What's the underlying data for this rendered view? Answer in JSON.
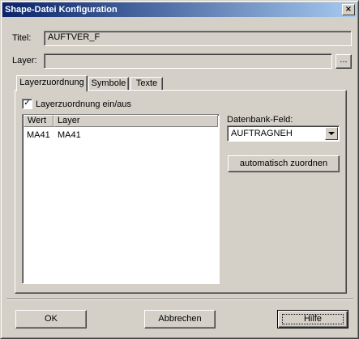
{
  "window": {
    "title": "Shape-Datei Konfiguration",
    "close_glyph": "×"
  },
  "fields": {
    "titel_label": "Titel:",
    "titel_value": "AUFTVER_F",
    "layer_label": "Layer:",
    "layer_value": "",
    "browse_label": "..."
  },
  "tabs": [
    "Layerzuordnung",
    "Symbole",
    "Texte"
  ],
  "layerzuordnung": {
    "checkbox_label": "Layerzuordnung ein/aus",
    "checkbox_checked": true,
    "checkbox_glyph": "✓",
    "columns": [
      "Wert",
      "Layer"
    ],
    "rows": [
      {
        "wert": "MA41",
        "layer": "MA41"
      }
    ],
    "db_field_label": "Datenbank-Feld:",
    "db_field_value": "AUFTRAGNEH",
    "auto_assign_label": "automatisch zuordnen"
  },
  "buttons": {
    "ok": "OK",
    "cancel": "Abbrechen",
    "help": "Hilfe"
  },
  "colors": {
    "face": "#d4d0c8",
    "title_start": "#0a246a",
    "title_end": "#a6caf0"
  }
}
